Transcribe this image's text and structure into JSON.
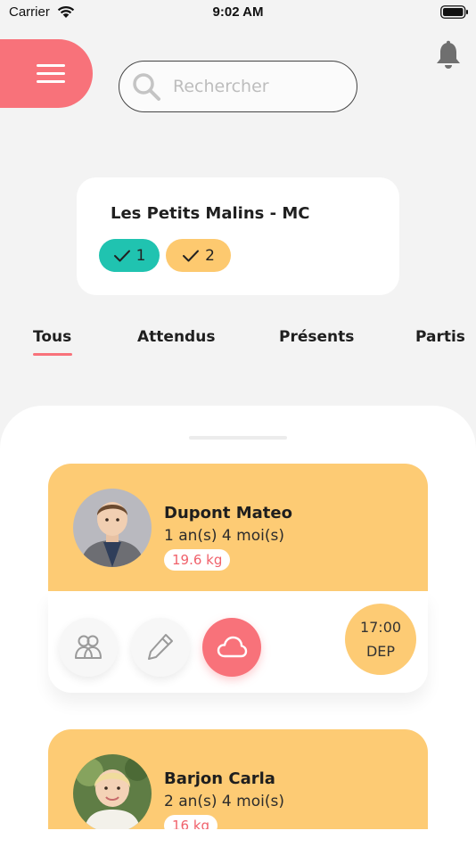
{
  "status_bar": {
    "carrier": "Carrier",
    "time": "9:02 AM"
  },
  "search": {
    "placeholder": "Rechercher"
  },
  "group": {
    "name": "Les Petits Malins - MC",
    "present_count": "1",
    "expected_count": "2"
  },
  "tabs": [
    "Tous",
    "Attendus",
    "Présents",
    "Partis"
  ],
  "active_tab": "Tous",
  "children": [
    {
      "name": "Dupont Mateo",
      "age": "1 an(s) 4 moi(s)",
      "weight": "19.6 kg",
      "time": "17:00",
      "status": "DEP"
    },
    {
      "name": "Barjon Carla",
      "age": "2 an(s) 4 moi(s)",
      "weight": "16 kg"
    }
  ],
  "icons": {
    "menu": "hamburger-icon",
    "search": "search-icon",
    "notifications": "bell-icon",
    "present": "check-icon",
    "expected": "check-icon",
    "parents": "parents-icon",
    "note": "pencil-icon",
    "weather": "cloud-icon"
  },
  "colors": {
    "accent": "#f8727a",
    "card_yellow": "#fdcb74",
    "present_green": "#20c3b0",
    "expected_yellow": "#fdc96f"
  }
}
